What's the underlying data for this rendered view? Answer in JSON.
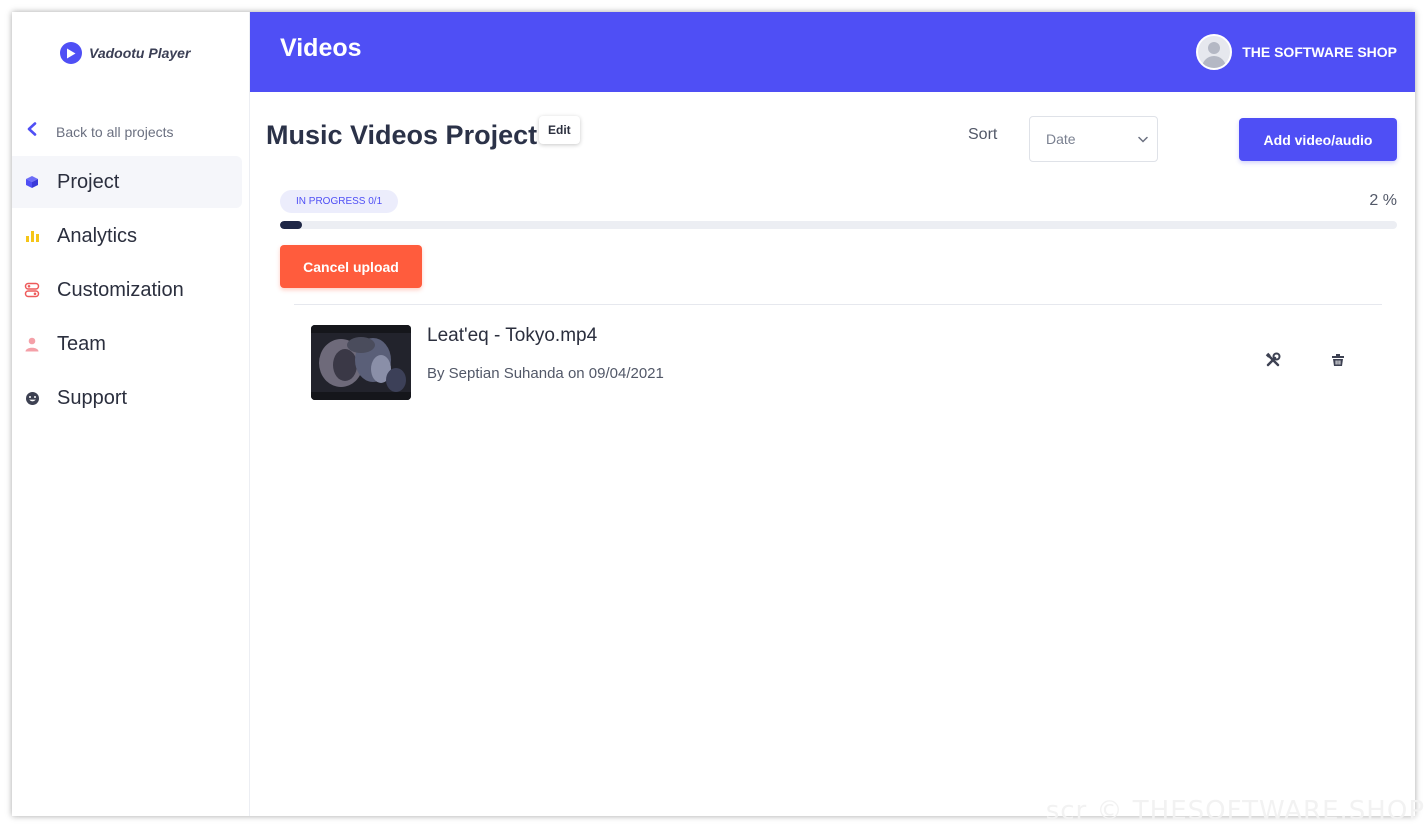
{
  "app": {
    "name": "Vadootu Player"
  },
  "header": {
    "title": "Videos",
    "account_name": "THE SOFTWARE SHOP"
  },
  "sidebar": {
    "back_label": "Back to all projects",
    "items": [
      {
        "label": "Project",
        "icon": "cube-icon",
        "active": true
      },
      {
        "label": "Analytics",
        "icon": "bar-chart-icon",
        "active": false
      },
      {
        "label": "Customization",
        "icon": "customization-icon",
        "active": false
      },
      {
        "label": "Team",
        "icon": "user-icon",
        "active": false
      },
      {
        "label": "Support",
        "icon": "smiley-icon",
        "active": false
      }
    ]
  },
  "project": {
    "title": "Music Videos Project",
    "edit_label": "Edit",
    "sort_label": "Sort",
    "sort_value": "Date",
    "add_label": "Add video/audio"
  },
  "upload": {
    "badge": "IN PROGRESS 0/1",
    "percent_text": "2 %",
    "percent": 2,
    "cancel_label": "Cancel upload"
  },
  "videos": [
    {
      "title": "Leat'eq - Tokyo.mp4",
      "meta": "By Septian Suhanda on 09/04/2021"
    }
  ],
  "watermark": "scr © THESOFTWARE.SHOP",
  "colors": {
    "accent": "#4f4ff5",
    "cancel": "#ff5c3d",
    "progress_fill": "#1f2746",
    "analytics_icon": "#f5c518",
    "customization_icon": "#ee5a5a",
    "team_icon": "#f4a0a8"
  }
}
